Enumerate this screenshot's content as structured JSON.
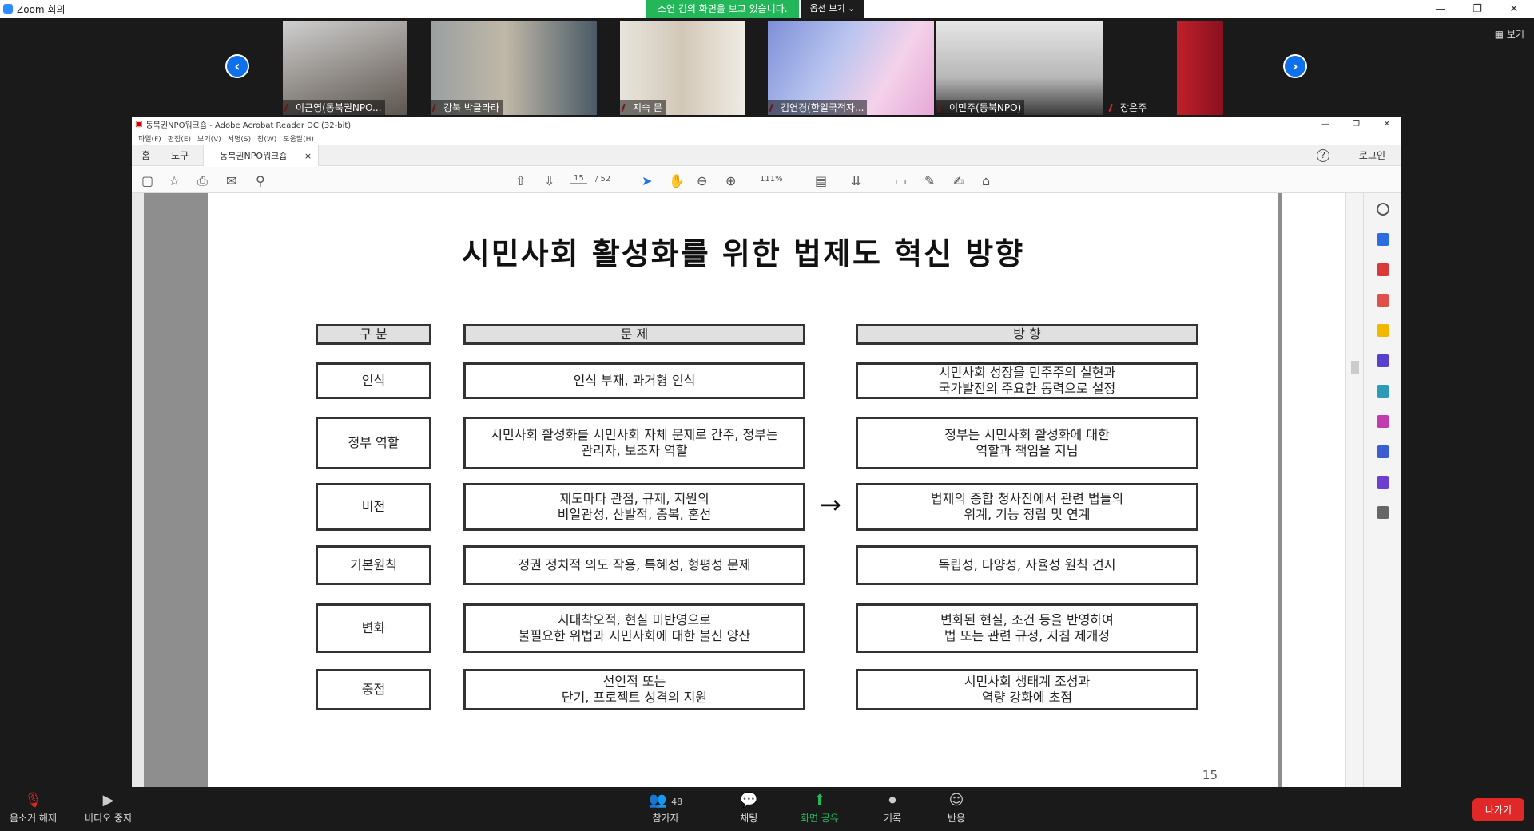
{
  "zoom_window": {
    "title": "Zoom 회의",
    "minimize": "—",
    "maximize": "❐",
    "close": "✕"
  },
  "share_banner": {
    "message": "소연 김의 화면을 보고 있습니다.",
    "options": "옵션 보기 ⌄"
  },
  "view_button": "▦ 보기",
  "gallery": {
    "prev": "‹",
    "next": "›",
    "participants": [
      {
        "name": "이근영(동북권NPO..."
      },
      {
        "name": "강북 박글라라"
      },
      {
        "name": "지숙 문"
      },
      {
        "name": "김연경(한일국적자..."
      },
      {
        "name": "이민주(동북NPO)"
      },
      {
        "name": "장은주"
      }
    ]
  },
  "acrobat": {
    "title": "동북권NPO워크숍 - Adobe Acrobat Reader DC (32-bit)",
    "menu": [
      "파일(F)",
      "편집(E)",
      "보기(V)",
      "서명(S)",
      "창(W)",
      "도움말(H)"
    ],
    "tabs": {
      "home": "홈",
      "tools": "도구",
      "doc": "동북권NPO워크숍",
      "doc_close": "×"
    },
    "help": "?",
    "login": "로그인",
    "page_current": "15",
    "page_total": "/ 52",
    "zoom": "111%"
  },
  "slide": {
    "title": "시민사회 활성화를 위한 법제도 혁신 방향",
    "headers": {
      "category": "구 분",
      "problem": "문 제",
      "direction": "방 향"
    },
    "arrow": "→",
    "rows": [
      {
        "category": "인식",
        "problem": [
          "인식 부재, 과거형 인식"
        ],
        "direction": [
          "시민사회 성장을 민주주의 실현과",
          "국가발전의 주요한 동력으로 설정"
        ]
      },
      {
        "category": "정부 역할",
        "problem": [
          "시민사회 활성화를 시민사회 자체 문제로 간주, 정부는",
          "관리자, 보조자 역할"
        ],
        "direction": [
          "정부는 시민사회 활성화에 대한",
          "역할과 책임을 지님"
        ]
      },
      {
        "category": "비전",
        "problem": [
          "제도마다 관점, 규제, 지원의",
          "비일관성, 산발적, 중복, 혼선"
        ],
        "direction": [
          "법제의 종합 청사진에서 관련 법들의",
          "위계, 기능 정립 및 연계"
        ]
      },
      {
        "category": "기본원칙",
        "problem": [
          "정권 정치적 의도 작용, 특혜성, 형평성 문제"
        ],
        "direction": [
          "독립성, 다양성, 자율성 원칙 견지"
        ]
      },
      {
        "category": "변화",
        "problem": [
          "시대착오적, 현실 미반영으로",
          "불필요한 위법과 시민사회에 대한 불신 양산"
        ],
        "direction": [
          "변화된 현실, 조건 등을 반영하여",
          "법 또는 관련 규정, 지침 제개정"
        ]
      },
      {
        "category": "중점",
        "problem": [
          "선언적 또는",
          "단기, 프로젝트 성격의 지원"
        ],
        "direction": [
          "시민사회 생태계 조성과",
          "역량 강화에 초점"
        ]
      }
    ],
    "page_number": "15"
  },
  "zoom_bar": {
    "unmute": "음소거 해제",
    "stop_video": "비디오 중지",
    "participants": "참가자",
    "participant_count": "48",
    "chat": "채팅",
    "share": "화면 공유",
    "record": "기록",
    "reactions": "반응",
    "leave": "나가기"
  }
}
